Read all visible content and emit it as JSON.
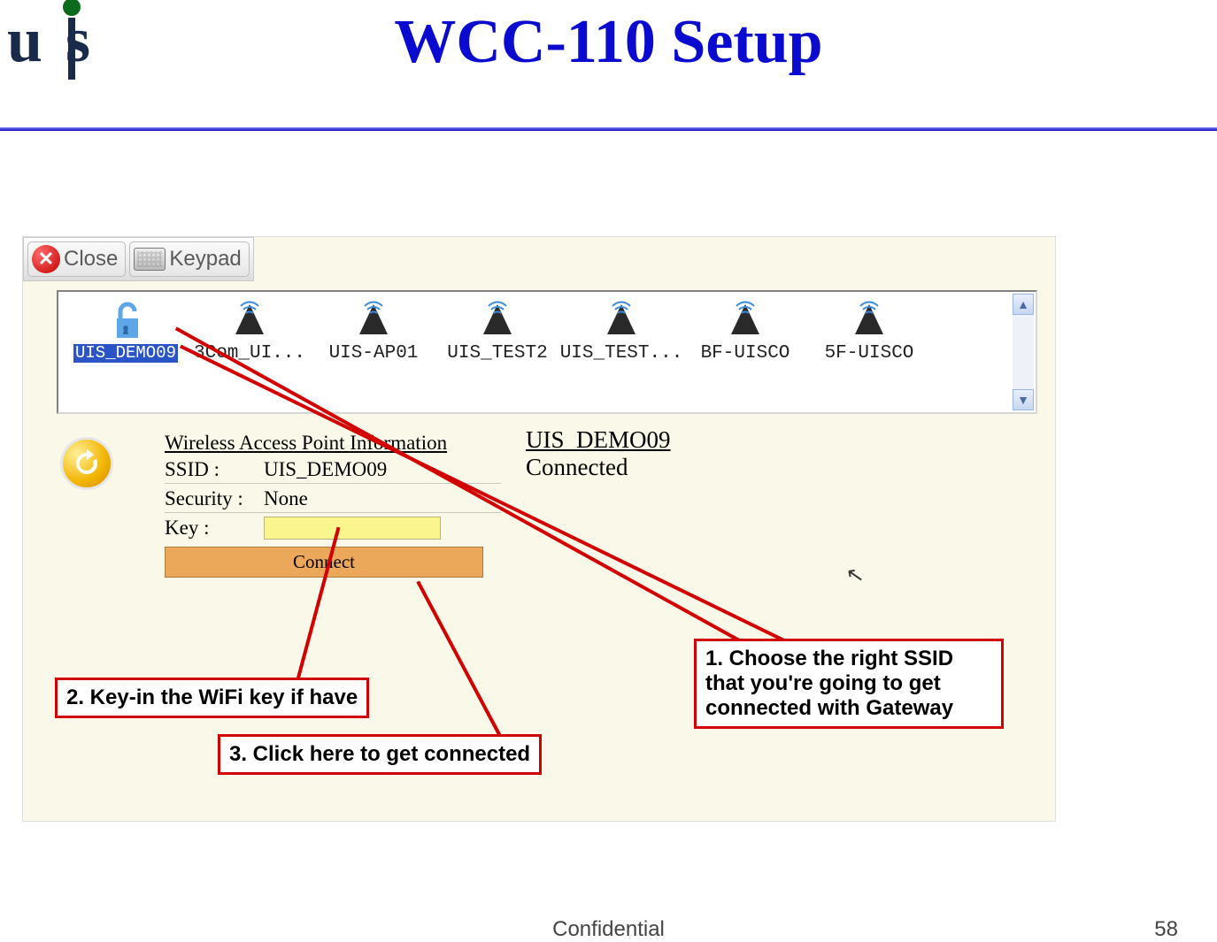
{
  "slide": {
    "title": "WCC-110 Setup",
    "confidential": "Confidential",
    "page": "58"
  },
  "logo": {
    "text_u": "u",
    "text_s": "s"
  },
  "toolbar": {
    "close": "Close",
    "keypad": "Keypad"
  },
  "ssids": {
    "selected": "UIS_DEMO09",
    "items": [
      "3Com_UI...",
      "UIS-AP01",
      "UIS_TEST2",
      "UIS_TEST...",
      "BF-UISCO",
      "5F-UISCO"
    ]
  },
  "info": {
    "title": "Wireless Access Point  Information",
    "ssid_label": "SSID :",
    "ssid_value": "UIS_DEMO09",
    "security_label": "Security :",
    "security_value": "None",
    "key_label": "Key :",
    "connect": "Connect"
  },
  "status": {
    "ssid": "UIS_DEMO09",
    "state": "Connected"
  },
  "callouts": {
    "c1": "1. Choose the right SSID that you're going to get connected with Gateway",
    "c2": "2. Key-in the WiFi key if have",
    "c3": "3. Click here to get connected"
  }
}
